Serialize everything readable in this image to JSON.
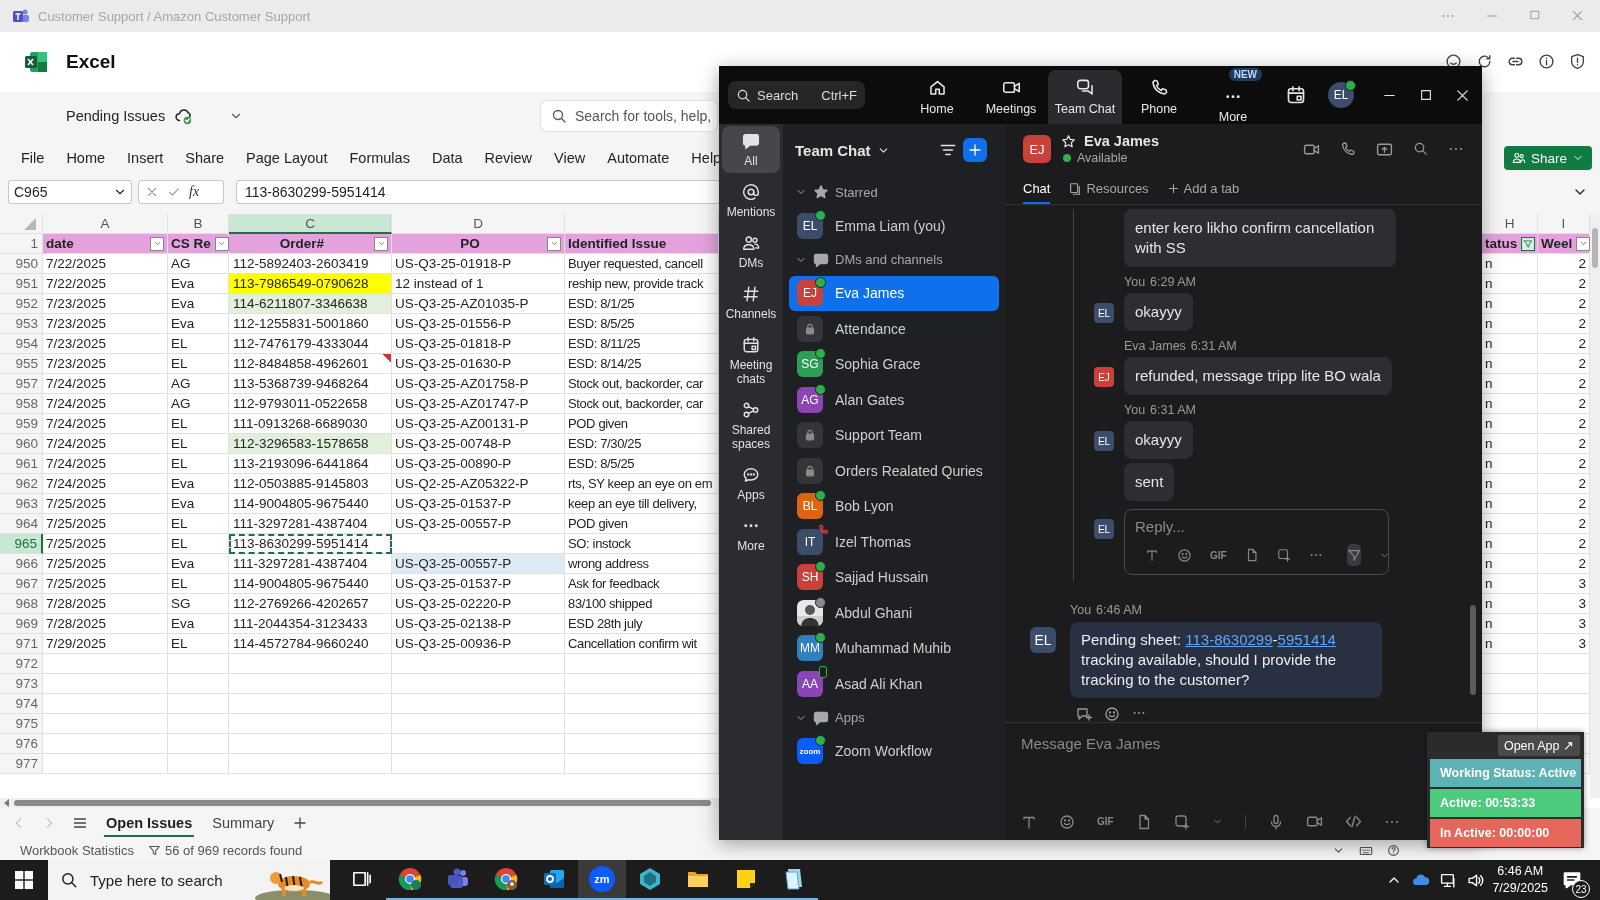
{
  "title_bar": {
    "title": "Customer Support / Amazon Customer Support"
  },
  "excel": {
    "app_name": "Excel",
    "workbook": "Pending Issues",
    "search_placeholder": "Search for tools, help,",
    "menu": [
      "File",
      "Home",
      "Insert",
      "Share",
      "Page Layout",
      "Formulas",
      "Data",
      "Review",
      "View",
      "Automate",
      "Help"
    ],
    "share_button": "Share",
    "name_box": "C965",
    "function_label": "fx",
    "formula": "113-8630299-5951414",
    "header_row_number": "1",
    "columns": [
      {
        "letter": "A",
        "header": "date",
        "filter_button": true,
        "filtered": false,
        "selected": false
      },
      {
        "letter": "B",
        "header": "CS Re",
        "filter_button": true,
        "filtered": false,
        "selected": false
      },
      {
        "letter": "C",
        "header": "Order#",
        "filter_button": true,
        "filtered": false,
        "selected": true
      },
      {
        "letter": "D",
        "header": "PO",
        "filter_button": true,
        "filtered": false,
        "selected": false
      },
      {
        "header": "Identified Issue",
        "filter_button": false,
        "selected": false
      },
      {
        "letter": "H",
        "header": "tatus",
        "filter_button": true,
        "filtered": true,
        "selected": false
      },
      {
        "letter": "I",
        "header": "Weel",
        "filter_button": true,
        "filtered": false,
        "selected": false
      }
    ],
    "rows": [
      {
        "number": "950",
        "date": "7/22/2025",
        "rep": "AG",
        "order": {
          "text": "112-5892403-2603419"
        },
        "po": {
          "text": "US-Q3-25-01918-P"
        },
        "issue": "Buyer requested, cancell",
        "status": "n",
        "week": "2",
        "selected": false,
        "comment": false
      },
      {
        "number": "951",
        "date": "7/22/2025",
        "rep": "Eva",
        "order": {
          "text": "113-7986549-0790628",
          "color": "#ffff00"
        },
        "po": {
          "text": "12 instead of 1"
        },
        "issue": "reship new, provide track",
        "status": "n",
        "week": "2",
        "selected": false,
        "comment": false
      },
      {
        "number": "952",
        "date": "7/23/2025",
        "rep": "Eva",
        "order": {
          "text": "114-6211807-3346638",
          "color": "#e2efda"
        },
        "po": {
          "text": "US-Q3-25-AZ01035-P"
        },
        "issue": "ESD: 8/1/25",
        "status": "n",
        "week": "2",
        "selected": false,
        "comment": false
      },
      {
        "number": "953",
        "date": "7/23/2025",
        "rep": "Eva",
        "order": {
          "text": "112-1255831-5001860"
        },
        "po": {
          "text": "US-Q3-25-01556-P"
        },
        "issue": "ESD: 8/5/25",
        "status": "n",
        "week": "2",
        "selected": false,
        "comment": false
      },
      {
        "number": "954",
        "date": "7/23/2025",
        "rep": "EL",
        "order": {
          "text": "112-7476179-4333044"
        },
        "po": {
          "text": "US-Q3-25-01818-P"
        },
        "issue": "ESD: 8/11/25",
        "status": "n",
        "week": "2",
        "selected": false,
        "comment": false
      },
      {
        "number": "955",
        "date": "7/23/2025",
        "rep": "EL",
        "order": {
          "text": "112-8484858-4962601"
        },
        "po": {
          "text": "US-Q3-25-01630-P"
        },
        "issue": "ESD: 8/14/25",
        "status": "n",
        "week": "2",
        "selected": false,
        "comment": true
      },
      {
        "number": "957",
        "date": "7/24/2025",
        "rep": "AG",
        "order": {
          "text": "113-5368739-9468264"
        },
        "po": {
          "text": "US-Q3-25-AZ01758-P"
        },
        "issue": "Stock out, backorder, car",
        "status": "n",
        "week": "2",
        "selected": false,
        "comment": false
      },
      {
        "number": "958",
        "date": "7/24/2025",
        "rep": "AG",
        "order": {
          "text": "112-9793011-0522658"
        },
        "po": {
          "text": "US-Q3-25-AZ01747-P"
        },
        "issue": "Stock out, backorder, car",
        "status": "n",
        "week": "2",
        "selected": false,
        "comment": false
      },
      {
        "number": "959",
        "date": "7/24/2025",
        "rep": "EL",
        "order": {
          "text": "111-0913268-6689030"
        },
        "po": {
          "text": "US-Q3-25-AZ00131-P"
        },
        "issue": "POD given",
        "status": "n",
        "week": "2",
        "selected": false,
        "comment": false
      },
      {
        "number": "960",
        "date": "7/24/2025",
        "rep": "EL",
        "order": {
          "text": "112-3296583-1578658",
          "color": "#e2efda"
        },
        "po": {
          "text": "US-Q3-25-00748-P"
        },
        "issue": "ESD: 7/30/25",
        "status": "n",
        "week": "2",
        "selected": false,
        "comment": false
      },
      {
        "number": "961",
        "date": "7/24/2025",
        "rep": "EL",
        "order": {
          "text": "113-2193096-6441864"
        },
        "po": {
          "text": "US-Q3-25-00890-P"
        },
        "issue": "ESD: 8/5/25",
        "status": "n",
        "week": "2",
        "selected": false,
        "comment": false
      },
      {
        "number": "962",
        "date": "7/24/2025",
        "rep": "Eva",
        "order": {
          "text": "112-0503885-9145803"
        },
        "po": {
          "text": "US-Q2-25-AZ05322-P"
        },
        "issue": "rts, SY keep an eye on em",
        "status": "n",
        "week": "2",
        "selected": false,
        "comment": false
      },
      {
        "number": "963",
        "date": "7/25/2025",
        "rep": "Eva",
        "order": {
          "text": "114-9004805-9675440"
        },
        "po": {
          "text": "US-Q3-25-01537-P"
        },
        "issue": "keep an eye till delivery,",
        "status": "n",
        "week": "2",
        "selected": false,
        "comment": false
      },
      {
        "number": "964",
        "date": "7/25/2025",
        "rep": "EL",
        "order": {
          "text": "111-3297281-4387404"
        },
        "po": {
          "text": "US-Q3-25-00557-P"
        },
        "issue": "POD given",
        "status": "n",
        "week": "2",
        "selected": false,
        "comment": false
      },
      {
        "number": "965",
        "date": "7/25/2025",
        "rep": "EL",
        "order": {
          "text": "113-8630299-5951414"
        },
        "issue": "SO: instock",
        "status": "n",
        "week": "2",
        "selected": true,
        "comment": false
      },
      {
        "number": "966",
        "date": "7/25/2025",
        "rep": "Eva",
        "order": {
          "text": "111-3297281-4387404"
        },
        "po": {
          "text": "US-Q3-25-00557-P",
          "color": "#ddebf7"
        },
        "issue": "wrong address",
        "status": "n",
        "week": "2",
        "selected": false,
        "comment": false
      },
      {
        "number": "967",
        "date": "7/25/2025",
        "rep": "EL",
        "order": {
          "text": "114-9004805-9675440"
        },
        "po": {
          "text": "US-Q3-25-01537-P"
        },
        "issue": "Ask for feedback",
        "status": "n",
        "week": "3",
        "selected": false,
        "comment": false
      },
      {
        "number": "968",
        "date": "7/28/2025",
        "rep": "SG",
        "order": {
          "text": "112-2769266-4202657"
        },
        "po": {
          "text": "US-Q3-25-02220-P"
        },
        "issue": "83/100 shipped",
        "status": "n",
        "week": "3",
        "selected": false,
        "comment": false
      },
      {
        "number": "969",
        "date": "7/28/2025",
        "rep": "Eva",
        "order": {
          "text": "111-2044354-3123433"
        },
        "po": {
          "text": "US-Q3-25-02138-P"
        },
        "issue": "ESD 28th july",
        "status": "n",
        "week": "3",
        "selected": false,
        "comment": false
      },
      {
        "number": "971",
        "date": "7/29/2025",
        "rep": "EL",
        "order": {
          "text": "114-4572784-9660240"
        },
        "po": {
          "text": "US-Q3-25-00936-P"
        },
        "issue": "Cancellation confirm wit",
        "status": "n",
        "week": "3",
        "selected": false,
        "comment": false
      }
    ],
    "empty_rows": [
      "972",
      "973",
      "974",
      "975",
      "976",
      "977"
    ],
    "sheet_tabs": [
      {
        "label": "Open Issues",
        "selected": true
      },
      {
        "label": "Summary",
        "selected": false
      }
    ],
    "status_bar": {
      "stats": "Workbook Statistics",
      "records": "56 of 969 records found"
    }
  },
  "zoom": {
    "search": {
      "placeholder": "Search",
      "shortcut": "Ctrl+F"
    },
    "nav": [
      {
        "label": "Home",
        "selected": false
      },
      {
        "label": "Meetings",
        "selected": false
      },
      {
        "label": "Team Chat",
        "selected": true
      },
      {
        "label": "Phone",
        "selected": false
      },
      {
        "label": "More",
        "selected": false,
        "badge": "NEW"
      }
    ],
    "user": {
      "initials": "EL",
      "color": "#3b4d6b"
    },
    "rail": [
      {
        "label": "All",
        "selected": true
      },
      {
        "label": "Mentions",
        "selected": false
      },
      {
        "label": "DMs",
        "selected": false
      },
      {
        "label": "Channels",
        "selected": false
      },
      {
        "label": "Meeting chats",
        "selected": false
      },
      {
        "label": "Shared spaces",
        "selected": false
      },
      {
        "label": "Apps",
        "selected": false
      },
      {
        "label": "More",
        "selected": false
      }
    ],
    "list_title": "Team Chat",
    "sections": [
      {
        "label": "Starred",
        "expanded": true,
        "items": [
          {
            "kind": "person",
            "name": "Emma Liam (you)",
            "initials": "EL",
            "color": "#3b4d6b",
            "online": true,
            "selected": false
          }
        ]
      },
      {
        "label": "DMs and channels",
        "expanded": true,
        "items": [
          {
            "kind": "person",
            "name": "Eva James",
            "initials": "EJ",
            "color": "#c8413b",
            "online": true,
            "selected": true
          },
          {
            "kind": "channel",
            "name": "Attendance",
            "online": false,
            "selected": false
          },
          {
            "kind": "person",
            "name": "Sophia Grace",
            "initials": "SG",
            "color": "#2e9e57",
            "online": true,
            "selected": false
          },
          {
            "kind": "person",
            "name": "Alan Gates",
            "initials": "AG",
            "color": "#8b45b5",
            "online": true,
            "selected": false
          },
          {
            "kind": "channel",
            "name": "Support Team",
            "online": false,
            "selected": false
          },
          {
            "kind": "channel",
            "name": "Orders Realated Quries",
            "online": false,
            "selected": false
          },
          {
            "kind": "person",
            "name": "Bob Lyon",
            "initials": "BL",
            "color": "#dd6512",
            "online": true,
            "selected": false
          },
          {
            "kind": "person",
            "name": "Izel Thomas",
            "initials": "IT",
            "color": "#3b4d6b",
            "on_call": true,
            "selected": false
          },
          {
            "kind": "person",
            "name": "Sajjad Hussain",
            "initials": "SH",
            "color": "#c8413b",
            "online": true,
            "selected": false
          },
          {
            "name": "Abdul Ghani",
            "away": true,
            "selected": false
          },
          {
            "kind": "person",
            "name": "Muhammad Muhib",
            "initials": "MM",
            "color": "#2f7fc1",
            "online": true,
            "selected": false
          },
          {
            "kind": "person",
            "name": "Asad Ali Khan",
            "initials": "AA",
            "color": "#8b45b5",
            "mobile": true,
            "selected": false
          }
        ]
      },
      {
        "label": "Apps",
        "expanded": true,
        "items": [
          {
            "kind": "app",
            "name": "Zoom Workflow",
            "initials": "zoom",
            "color": "#0b5cff",
            "online": true,
            "selected": false
          }
        ]
      }
    ],
    "conversation": {
      "name": "Eva James",
      "initials": "EJ",
      "color": "#c8413b",
      "status": "Available",
      "tabs": [
        {
          "label": "Chat",
          "selected": true
        },
        {
          "label": "Resources",
          "selected": false
        },
        {
          "label": "Add a tab",
          "selected": false
        }
      ],
      "thread": [
        {
          "texts": [
            "enter kero likho confirm cancellation with SS"
          ]
        },
        {
          "author": "You",
          "time": "6:29 AM",
          "initials": "EL",
          "color": "#3b4d6b",
          "texts": [
            "okayyy"
          ]
        },
        {
          "author": "Eva James",
          "time": "6:31 AM",
          "initials": "EJ",
          "color": "#c8413b",
          "texts": [
            "refunded, message tripp lite BO wala"
          ]
        },
        {
          "author": "You",
          "time": "6:31 AM",
          "initials": "EL",
          "color": "#3b4d6b",
          "texts": [
            "okayyy",
            "sent"
          ]
        }
      ],
      "reply": {
        "initials": "EL",
        "placeholder": "Reply...",
        "gif": "GIF"
      },
      "message": {
        "author": "You",
        "time": "6:46 AM",
        "initials": "EL",
        "parts": [
          {
            "kind": "text",
            "text": "Pending sheet: "
          },
          {
            "kind": "link",
            "text": "113-8630299"
          },
          {
            "kind": "text",
            "text": "-"
          },
          {
            "kind": "link",
            "text": "5951414"
          },
          {
            "kind": "text",
            "text": " tracking available, should I provide the tracking to the customer?"
          }
        ]
      },
      "composer": {
        "placeholder": "Message Eva James",
        "gif": "GIF"
      }
    }
  },
  "status_widget": {
    "open_app": "Open App ↗",
    "rows": [
      {
        "text": "Working Status: Active",
        "color": "#5db3b3"
      },
      {
        "text": "Active: 00:53:33",
        "color": "#4ccb7c"
      },
      {
        "text": "In Active: 00:00:00",
        "color": "#e5675c"
      }
    ]
  },
  "taskbar": {
    "search_placeholder": "Type here to search",
    "apps": [
      {
        "selected": false,
        "running": false
      },
      {
        "selected": false,
        "running": true
      },
      {
        "selected": false,
        "running": true
      },
      {
        "selected": false,
        "running": true
      },
      {
        "selected": false,
        "running": true
      },
      {
        "selected": true,
        "running": true,
        "label": "zm"
      },
      {
        "selected": false,
        "running": true
      },
      {
        "selected": false,
        "running": true
      },
      {
        "selected": false,
        "running": true
      },
      {
        "selected": false,
        "running": true
      }
    ],
    "time": "6:46 AM",
    "date": "7/29/2025",
    "notifications": "23"
  }
}
